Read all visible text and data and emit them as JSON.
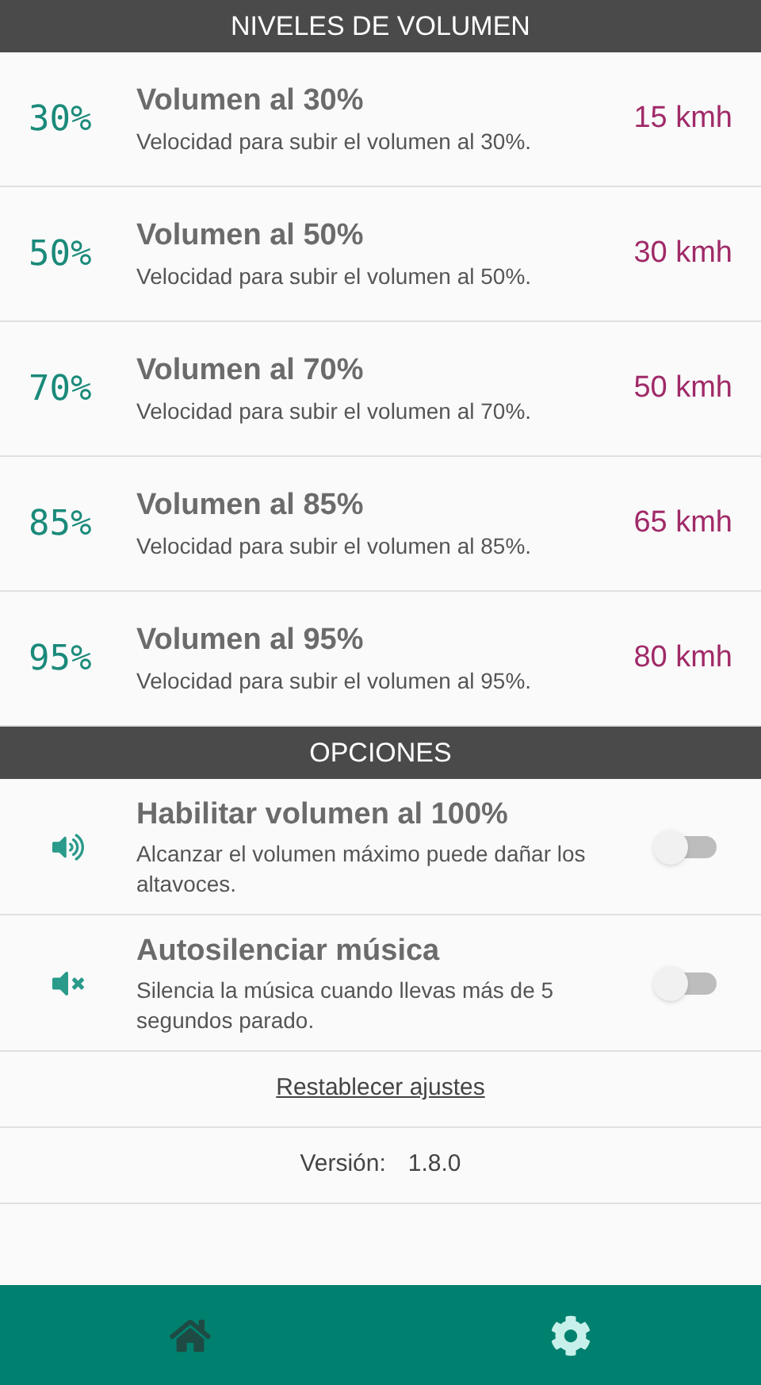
{
  "levels_header": "NIVELES DE VOLUMEN",
  "levels": [
    {
      "percent": "30%",
      "title": "Volumen al 30%",
      "description": "Velocidad para subir el volumen al 30%.",
      "speed": "15 kmh"
    },
    {
      "percent": "50%",
      "title": "Volumen al 50%",
      "description": "Velocidad para subir el volumen al 50%.",
      "speed": "30 kmh"
    },
    {
      "percent": "70%",
      "title": "Volumen al 70%",
      "description": "Velocidad para subir el volumen al 70%.",
      "speed": "50 kmh"
    },
    {
      "percent": "85%",
      "title": "Volumen al 85%",
      "description": "Velocidad para subir el volumen al 85%.",
      "speed": "65 kmh"
    },
    {
      "percent": "95%",
      "title": "Volumen al 95%",
      "description": "Velocidad para subir el volumen al 95%.",
      "speed": "80 kmh"
    }
  ],
  "options_header": "OPCIONES",
  "options": [
    {
      "kind": "volume",
      "title": "Habilitar volumen al 100%",
      "description": "Alcanzar el volumen máximo puede dañar los altavoces.",
      "on": false
    },
    {
      "kind": "mute",
      "title": "Autosilenciar música",
      "description": "Silencia la música cuando llevas más de 5 segundos parado.",
      "on": false
    }
  ],
  "reset_link": "Restablecer ajustes",
  "version": {
    "label": "Versión:",
    "value": "1.8.0"
  },
  "nav": [
    {
      "kind": "home",
      "selected": false
    },
    {
      "kind": "settings",
      "selected": true
    }
  ]
}
